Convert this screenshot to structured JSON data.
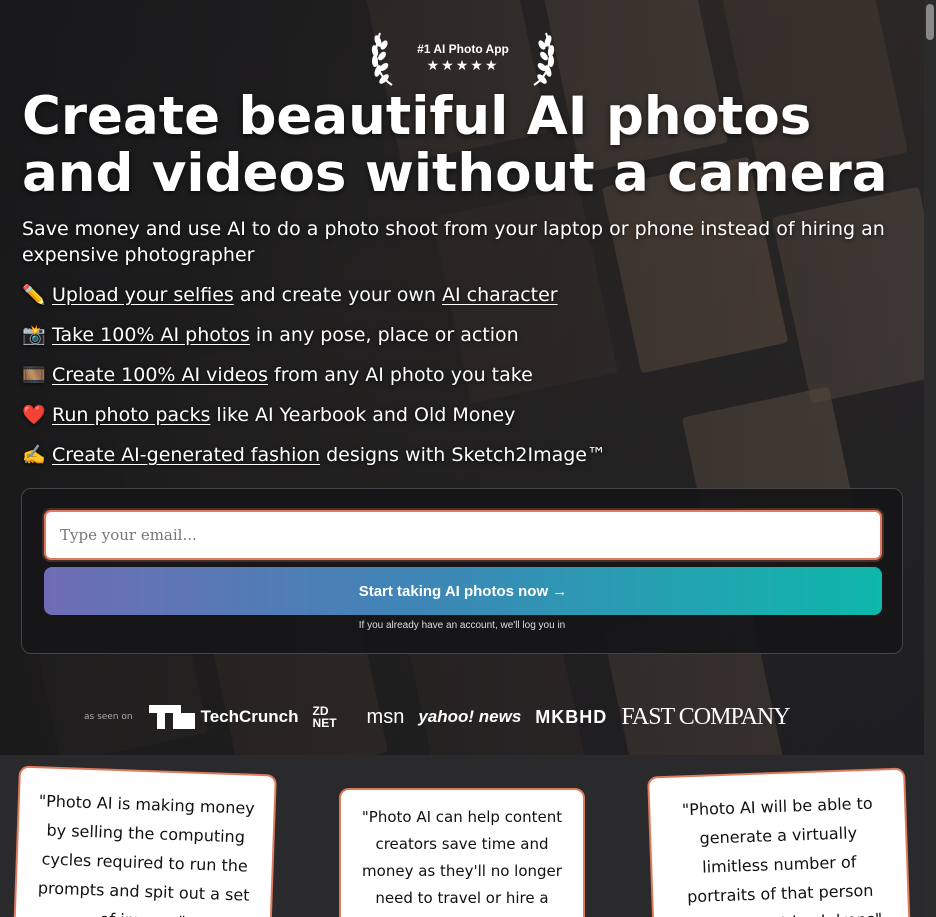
{
  "award": {
    "label": "#1 AI Photo App",
    "stars": "★★★★★"
  },
  "headline": "Create beautiful AI photos and videos without a camera",
  "subheadline": "Save money and use AI to do a photo shoot from your laptop or phone instead of hiring an expensive photographer",
  "features": [
    {
      "emoji": "✏️",
      "link": "Upload your selfies",
      "middle": " and create your own ",
      "link2": "AI character",
      "rest": ""
    },
    {
      "emoji": "📸",
      "link": "Take 100% AI photos",
      "rest": " in any pose, place or action"
    },
    {
      "emoji": "🎞️",
      "link": "Create 100% AI videos",
      "rest": " from any AI photo you take"
    },
    {
      "emoji": "❤️",
      "link": "Run photo packs",
      "rest": " like AI Yearbook and Old Money"
    },
    {
      "emoji": "✍️",
      "link": "Create AI-generated fashion",
      "rest": " designs with Sketch2Image™"
    }
  ],
  "form": {
    "email_placeholder": "Type your email...",
    "cta_label": "Start taking AI photos now →",
    "note": "If you already have an account, we'll log you in"
  },
  "press": {
    "seen_on": "as seen on",
    "logos": [
      "TechCrunch",
      "ZD NET",
      "msn",
      "yahoo! news",
      "MKBHD",
      "FAST COMPANY"
    ]
  },
  "testimonials": [
    "\"Photo AI is making money by selling the computing cycles required to run the prompts and spit out a set of images\"",
    "\"Photo AI can help content creators save time and money as they'll no longer need to travel or hire a photographer\"",
    "\"Photo AI will be able to generate a virtually limitless number of portraits of that person with different backdrops\""
  ],
  "colors": {
    "accent": "#e07a5f",
    "cta_start": "#6f6cb5",
    "cta_end": "#0eb8ab"
  }
}
